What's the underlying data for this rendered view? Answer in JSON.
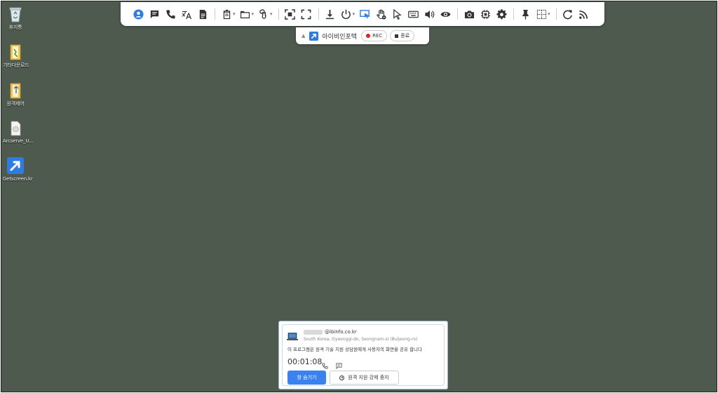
{
  "desktop_icons": [
    {
      "label": "휴지통",
      "icon": "recycle-bin-icon"
    },
    {
      "label": "기타다운로드",
      "icon": "folder-icon"
    },
    {
      "label": "원격제어",
      "icon": "folder-icon"
    },
    {
      "label": "Arcserve_U...",
      "icon": "file-icon"
    },
    {
      "label": "Getscreen.kr",
      "icon": "getscreen-app-icon"
    }
  ],
  "toolbar": {
    "icons": [
      "user-icon",
      "chat-icon",
      "phone-icon",
      "translate-icon",
      "document-icon",
      "clipboard-icon",
      "folder-icon",
      "command-icon",
      "screenshot-region-icon",
      "fullscreen-icon",
      "download-icon",
      "power-icon",
      "remote-view-icon",
      "hand-block-icon",
      "cursor-icon",
      "keyboard-icon",
      "volume-icon",
      "eye-icon",
      "camera-icon",
      "chip-icon",
      "settings-icon",
      "pin-icon",
      "grid-icon",
      "refresh-icon",
      "rss-icon"
    ]
  },
  "session": {
    "name": "아이비인포텍",
    "rec_label": "REC",
    "stop_label": "종료"
  },
  "panel": {
    "email": "@ibinfo.co.kr",
    "location": "South Korea, Gyeonggi-do, Seongnam-si (Buljeong-ro)",
    "message": "이 프로그램은 원격 기술 지원 상담원에게 사용자의 화면을 공유 합니다",
    "timer": "00:01:08",
    "hide_label": "창 숨기기",
    "force_stop_label": "원격 지원 강제 중지"
  },
  "colors": {
    "desktop_bg": "#4f5a4f",
    "accent": "#3a82f0",
    "rec": "#dd2222"
  }
}
